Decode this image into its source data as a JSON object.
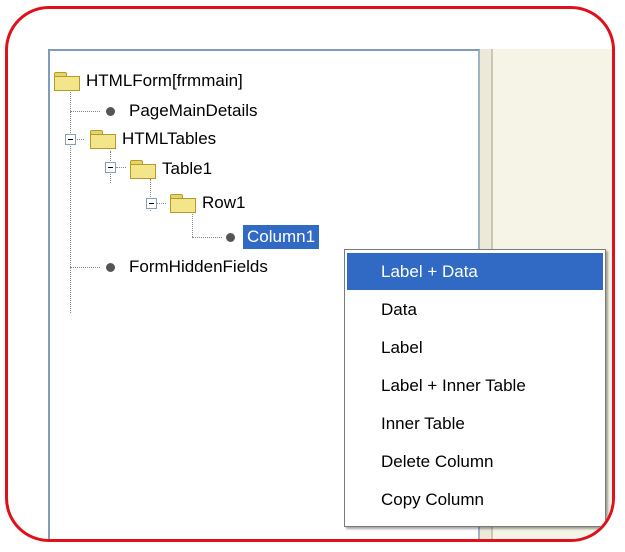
{
  "tree": {
    "root": {
      "label": "HTMLForm[frmmain]",
      "icon": "folder-icon"
    },
    "page_main_details": {
      "label": "PageMainDetails",
      "icon": "node-dot-icon"
    },
    "html_tables": {
      "label": "HTMLTables",
      "icon": "folder-icon",
      "expanded": true
    },
    "table1": {
      "label": "Table1",
      "icon": "folder-icon",
      "expanded": true
    },
    "row1": {
      "label": "Row1",
      "icon": "folder-icon",
      "expanded": true
    },
    "column1": {
      "label": "Column1",
      "icon": "node-dot-icon",
      "selected": true
    },
    "form_hidden_fields": {
      "label": "FormHiddenFields",
      "icon": "node-dot-icon"
    }
  },
  "context_menu": {
    "items": [
      {
        "label": "Label + Data",
        "highlighted": true
      },
      {
        "label": "Data"
      },
      {
        "label": "Label"
      },
      {
        "label": "Label + Inner Table"
      },
      {
        "label": "Inner Table"
      },
      {
        "label": "Delete Column"
      },
      {
        "label": "Copy Column"
      }
    ]
  },
  "colors": {
    "highlight": "#316ac5",
    "annotation_border": "#e0101a",
    "right_pane_bg": "#f5f4e6"
  }
}
